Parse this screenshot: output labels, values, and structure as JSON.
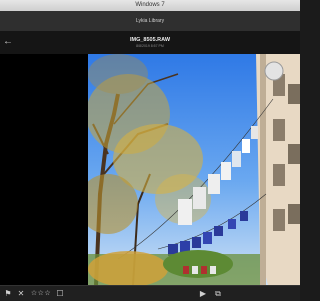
{
  "os_window": {
    "title": "Windows 7"
  },
  "app": {
    "title": "Lykia Library"
  },
  "header": {
    "filename": "IMG_8505.RAW",
    "meta": "8/8/2019 8:57 PM"
  },
  "icons": {
    "back": "←",
    "flag": "⚑",
    "reject": "✕",
    "stars": "☆☆☆",
    "comment": "☐",
    "play": "▶",
    "slideshow": "⧉"
  },
  "colors": {
    "sky": "#8ab8ea",
    "foliage": "#c9a53a",
    "laundry": "#2a3a9a"
  }
}
